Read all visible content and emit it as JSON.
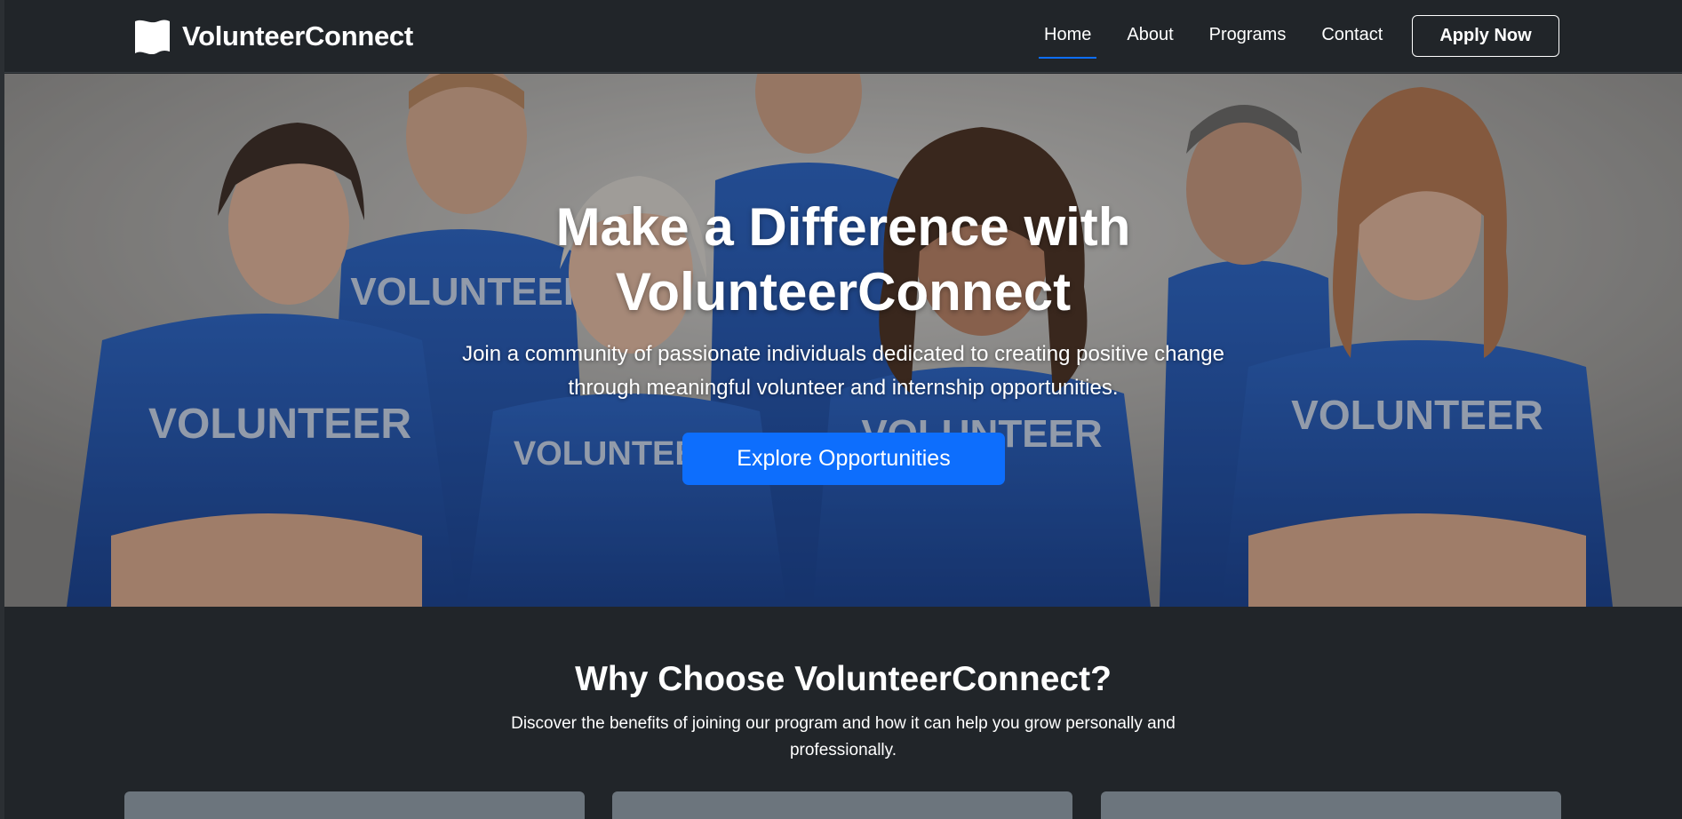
{
  "navbar": {
    "brand_name": "VolunteerConnect",
    "brand_icon": "flag-icon",
    "links": [
      {
        "label": "Home",
        "active": true
      },
      {
        "label": "About",
        "active": false
      },
      {
        "label": "Programs",
        "active": false
      },
      {
        "label": "Contact",
        "active": false
      }
    ],
    "cta_label": "Apply Now"
  },
  "hero": {
    "title_line1": "Make a Difference with",
    "title_line2": "VolunteerConnect",
    "subtitle_line1": "Join a community of passionate individuals dedicated to creating positive change",
    "subtitle_line2": "through meaningful volunteer and internship opportunities.",
    "button_label": "Explore Opportunities",
    "photo_description_icon": "volunteer-group-photo",
    "shirt_text": "VOLUNTEER"
  },
  "why": {
    "title": "Why Choose VolunteerConnect?",
    "subtitle_line1": "Discover the benefits of joining our program and how it can help you grow personally and",
    "subtitle_line2": "professionally."
  },
  "colors": {
    "background": "#212529",
    "accent": "#0d6efd",
    "card": "#6c757d",
    "shirt_blue": "#1f56b8"
  }
}
